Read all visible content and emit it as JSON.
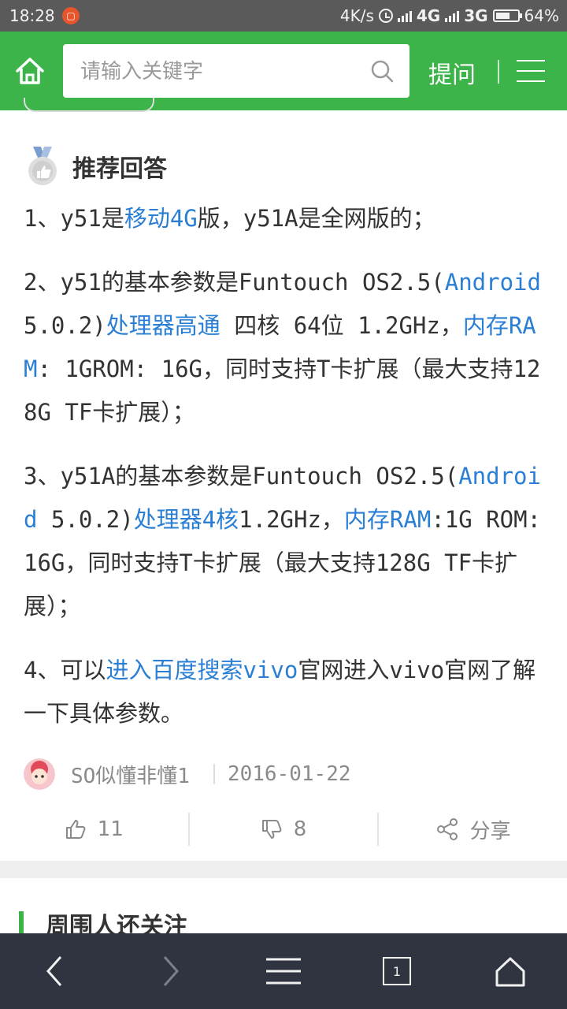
{
  "status_bar": {
    "time": "18:28",
    "speed": "4K/s",
    "net1": "4G",
    "net2": "3G",
    "battery": "64%",
    "battery_level": 0.64
  },
  "header": {
    "search_placeholder": "请输入关键字",
    "ask_label": "提问",
    "accent_color": "#3cb44a"
  },
  "answer": {
    "section_title": "推荐回答",
    "p1": {
      "a": "1、y51是",
      "link1": "移动4G",
      "b": "版，y51A是全网版的；"
    },
    "p2": {
      "a": "2、y51的基本参数是Funtouch OS2.5(",
      "link1": "Android",
      "b": " 5.0.2)",
      "link2": "处理器高通",
      "c": " 四核 64位 1.2GHz，",
      "link3": "内存RAM",
      "d": ": 1GROM: 16G，同时支持T卡扩展（最大支持128G TF卡扩展）；"
    },
    "p3": {
      "a": "3、y51A的基本参数是Funtouch OS2.5(",
      "link1": "Android",
      "b": " 5.0.2)",
      "link2": "处理器4核",
      "c": "1.2GHz，",
      "link3": "内存RAM",
      "d": ":1G ROM:16G，同时支持T卡扩展（最大支持128G TF卡扩展）；"
    },
    "p4": {
      "a": "4、可以",
      "link1": "进入百度搜索vivo",
      "b": "官网进入vivo官网了解一下具体参数。"
    },
    "link_color": "#2a7fd4",
    "author": "SO似懂非懂1",
    "date": "2016-01-22",
    "likes": "11",
    "dislikes": "8",
    "share_label": "分享"
  },
  "related": {
    "title": "周围人还关注"
  },
  "bottom_nav": {
    "tab_count": "1"
  }
}
